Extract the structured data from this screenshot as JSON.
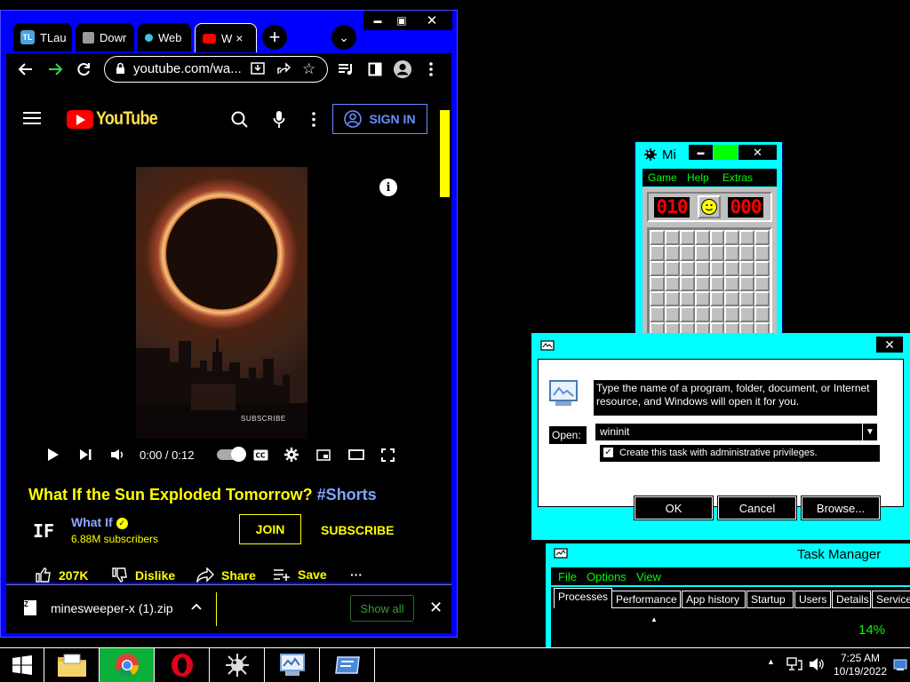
{
  "chrome": {
    "tabs": [
      {
        "label": "TLau",
        "favicon": "TL",
        "icon": "tlauncher-icon"
      },
      {
        "label": "Dowr",
        "favicon": "",
        "icon": "box-icon"
      },
      {
        "label": "Web",
        "favicon": "",
        "icon": "web-icon"
      },
      {
        "label": "W",
        "favicon": "",
        "icon": "youtube-icon"
      }
    ],
    "tab_close": "×",
    "new_tab": "+",
    "tab_search": "⌄",
    "win_minimize": "▬",
    "win_maximize": "▣",
    "win_close": "✕",
    "url": "youtube.com/wa...",
    "colors": {
      "frame": "#0000ff",
      "accent": "#ffff00"
    }
  },
  "youtube": {
    "logo": "YouTube",
    "sign_in": "SIGN IN",
    "video_watermark": "SUBSCRIBE",
    "time": "0:00 / 0:12",
    "title": "What If the Sun Exploded Tomorrow?",
    "hashtag": "#Shorts",
    "channel_initials": "IF",
    "channel_name": "What If",
    "verified_mark": "✓",
    "subscribers": "6.88M subscribers",
    "join": "JOIN",
    "subscribe": "SUBSCRIBE",
    "likes": "207K",
    "dislike": "Dislike",
    "share": "Share",
    "save": "Save",
    "more": "···"
  },
  "download": {
    "filename": "minesweeper-x (1).zip",
    "file_icon_text": "Z",
    "show_all": "Show all",
    "close": "✕"
  },
  "minesweeper": {
    "title": "Mi",
    "menu": [
      "Game",
      "Help",
      "Extras"
    ],
    "mine_counter": "010",
    "timer": "000",
    "close": "✕",
    "minimize": "▬"
  },
  "run_dialog": {
    "close": "✕",
    "description": "Type the name of a program, folder, document, or Internet resource, and Windows will open it for you.",
    "open_label": "Open:",
    "open_value": "wininit",
    "admin_checkbox": "Create this task with administrative privileges.",
    "admin_checked": "✓",
    "ok": "OK",
    "cancel": "Cancel",
    "browse": "Browse..."
  },
  "task_manager": {
    "title": "Task Manager",
    "menu": [
      "File",
      "Options",
      "View"
    ],
    "tabs": [
      "Processes",
      "Performance",
      "App history",
      "Startup",
      "Users",
      "Details",
      "Services"
    ],
    "cpu_percent": "14%"
  },
  "taskbar": {
    "time": "7:25 AM",
    "date": "10/19/2022"
  }
}
